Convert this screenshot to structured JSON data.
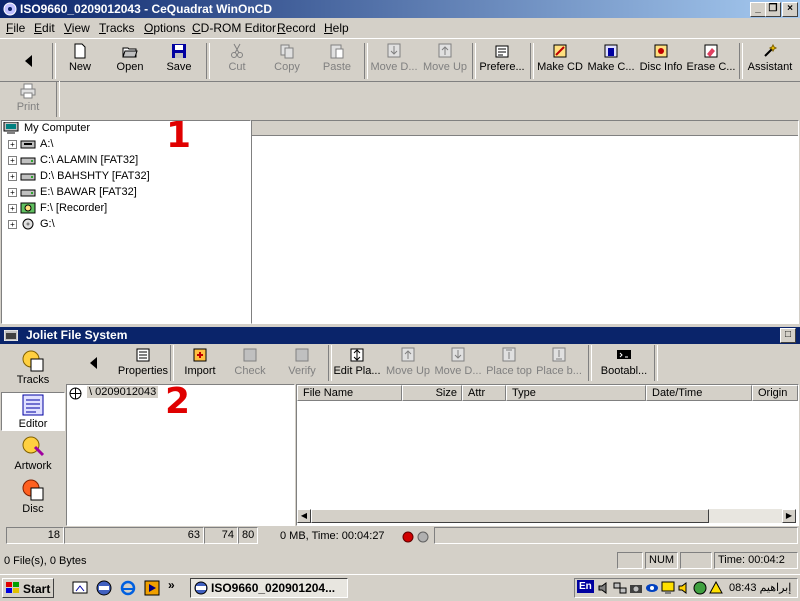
{
  "window": {
    "title": "ISO9660_0209012043 - CeQuadrat WinOnCD"
  },
  "menu": [
    "File",
    "Edit",
    "View",
    "Tracks",
    "Options",
    "CD-ROM Editor",
    "Record",
    "Help"
  ],
  "toolbar": {
    "new": "New",
    "open": "Open",
    "save": "Save",
    "cut": "Cut",
    "copy": "Copy",
    "paste": "Paste",
    "move_down": "Move D...",
    "move_up": "Move Up",
    "preferences": "Prefere...",
    "make_cd": "Make CD",
    "make_c": "Make C...",
    "disc_info": "Disc Info",
    "erase": "Erase C...",
    "assistant": "Assistant",
    "print": "Print"
  },
  "tree": {
    "root": "My Computer",
    "drives": [
      "A:\\",
      "C:\\ ALAMIN [FAT32]",
      "D:\\ BAHSHTY [FAT32]",
      "E:\\ BAWAR [FAT32]",
      "F:\\ [Recorder]",
      "G:\\"
    ]
  },
  "annotations": {
    "one": "1",
    "two": "2"
  },
  "joliet": {
    "title": "Joliet File System",
    "toolbar": {
      "properties": "Properties",
      "import": "Import",
      "check": "Check",
      "verify": "Verify",
      "edit_playlist": "Edit Pla...",
      "move_up": "Move Up",
      "move_down": "Move D...",
      "place_top": "Place top",
      "place_bottom": "Place b...",
      "bootable": "Bootabl..."
    },
    "sidebar": [
      "Tracks",
      "Editor",
      "Artwork",
      "Disc"
    ],
    "root_folder": "\\ 0209012043",
    "columns": [
      "File Name",
      "Size",
      "Attr",
      "Type",
      "Date/Time",
      "Origin"
    ],
    "status": {
      "v1": "18",
      "v2": "63",
      "v3": "74",
      "v4": "80",
      "info": "0 MB, Time: 00:04:27"
    }
  },
  "statusbar": {
    "files": "0 File(s), 0 Bytes",
    "num": "NUM",
    "time": "Time: 00:04:2"
  },
  "taskbar": {
    "start": "Start",
    "task": "ISO9660_020901204...",
    "clock": "08:43 إبراهيم",
    "lang": "En"
  },
  "colors": {
    "title_active": "#0a246a",
    "annotation": "#e00000"
  }
}
